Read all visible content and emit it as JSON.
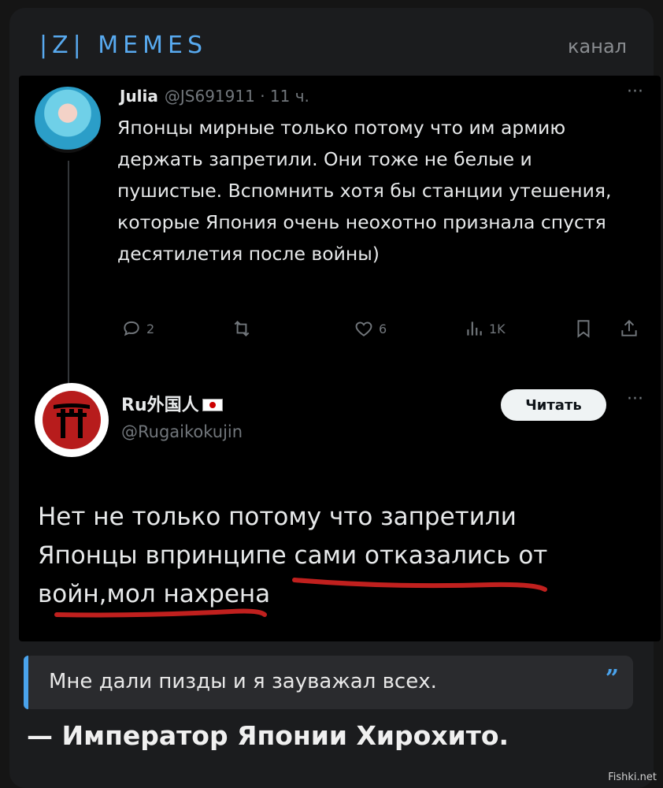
{
  "channel": {
    "name": "|Z| MEMES",
    "tag": "канал"
  },
  "tweet1": {
    "author_name": "Julia",
    "handle_time": "@JS691911 · 11 ч.",
    "more": "···",
    "text": "Японцы мирные только потому что им армию держать запретили. Они тоже не белые и пушистые. Вспомнить хотя бы станции утешения, которые Япония очень неохотно признала спустя десятилетия после войны)",
    "replies": "2",
    "likes": "6",
    "views": "1K"
  },
  "tweet2": {
    "author_name": "Ru外国人",
    "handle": "@Rugaikokujin",
    "read_button": "Читать",
    "more": "···",
    "text_line1": "Нет не только потому что запретили",
    "text_line2_pre": "Японцы впринципе ",
    "text_line2_underlined": "сами отказались от",
    "text_line3": "войн,мол нахрена"
  },
  "quote": {
    "text": "Мне дали пизды и я зауважал всех.",
    "mark": "”"
  },
  "signature": "— Император Японии Хирохито.",
  "watermark": "Fishki.net",
  "colors": {
    "accent": "#4aa3ec",
    "underline": "#c0201e",
    "background": "#1b1c1e"
  }
}
